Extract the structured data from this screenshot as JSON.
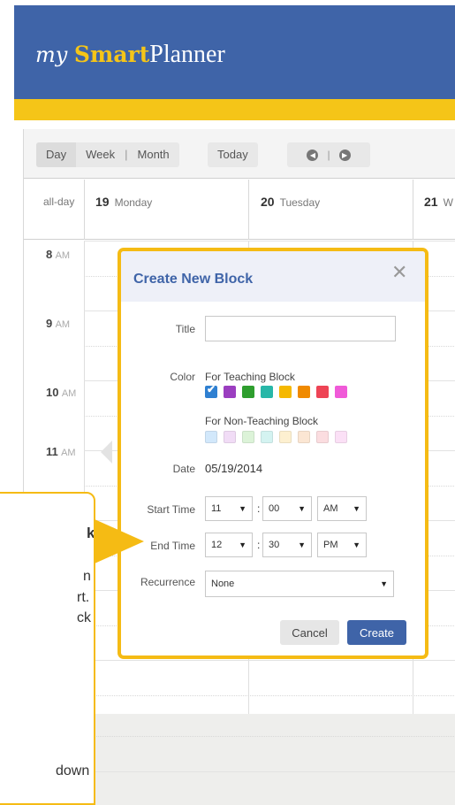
{
  "header": {
    "brand_my": "my",
    "brand_smart": "Smart",
    "brand_planner": "Planner",
    "colors": {
      "header_bg": "#3f64a8",
      "accent": "#f5c518"
    }
  },
  "toolbar": {
    "view_day": "Day",
    "view_week": "Week",
    "view_month": "Month",
    "today": "Today",
    "prev_icon": "circle-left-arrow-icon",
    "next_icon": "circle-right-arrow-icon"
  },
  "day_header": {
    "all_day": "all-day",
    "days": [
      {
        "num": "19",
        "name": "Monday"
      },
      {
        "num": "20",
        "name": "Tuesday"
      },
      {
        "num": "21",
        "name": "W"
      }
    ]
  },
  "hours": [
    {
      "num": "8",
      "ampm": "AM"
    },
    {
      "num": "9",
      "ampm": "AM"
    },
    {
      "num": "10",
      "ampm": "AM"
    },
    {
      "num": "11",
      "ampm": "AM"
    }
  ],
  "modal": {
    "title": "Create New Block",
    "close_icon": "close-icon",
    "title_label": "Title",
    "title_value": "",
    "color_label": "Color",
    "teaching_label": "For Teaching Block",
    "teaching_colors": [
      "#2f80d1",
      "#9b3ec0",
      "#2e9e2e",
      "#28b7a8",
      "#f5b800",
      "#f08a00",
      "#ee4455",
      "#f05ad8"
    ],
    "non_teaching_label": "For Non-Teaching Block",
    "non_teaching_colors": [
      "#d2e8fb",
      "#f1dcf6",
      "#dcf3d8",
      "#d4f3f1",
      "#fdf0d0",
      "#fbe6d3",
      "#fbdde0",
      "#fbe0f6"
    ],
    "selected_color_index": 0,
    "date_label": "Date",
    "date_value": "05/19/2014",
    "start_label": "Start Time",
    "start": {
      "hour": "11",
      "minute": "00",
      "ampm": "AM"
    },
    "end_label": "End Time",
    "end": {
      "hour": "12",
      "minute": "30",
      "ampm": "PM"
    },
    "recurrence_label": "Recurrence",
    "recurrence_value": "None",
    "cancel_label": "Cancel",
    "create_label": "Create"
  },
  "tooltip": {
    "line1": "k",
    "line2": "n",
    "line3": "rt.",
    "line4": "ck",
    "line5": "down"
  }
}
